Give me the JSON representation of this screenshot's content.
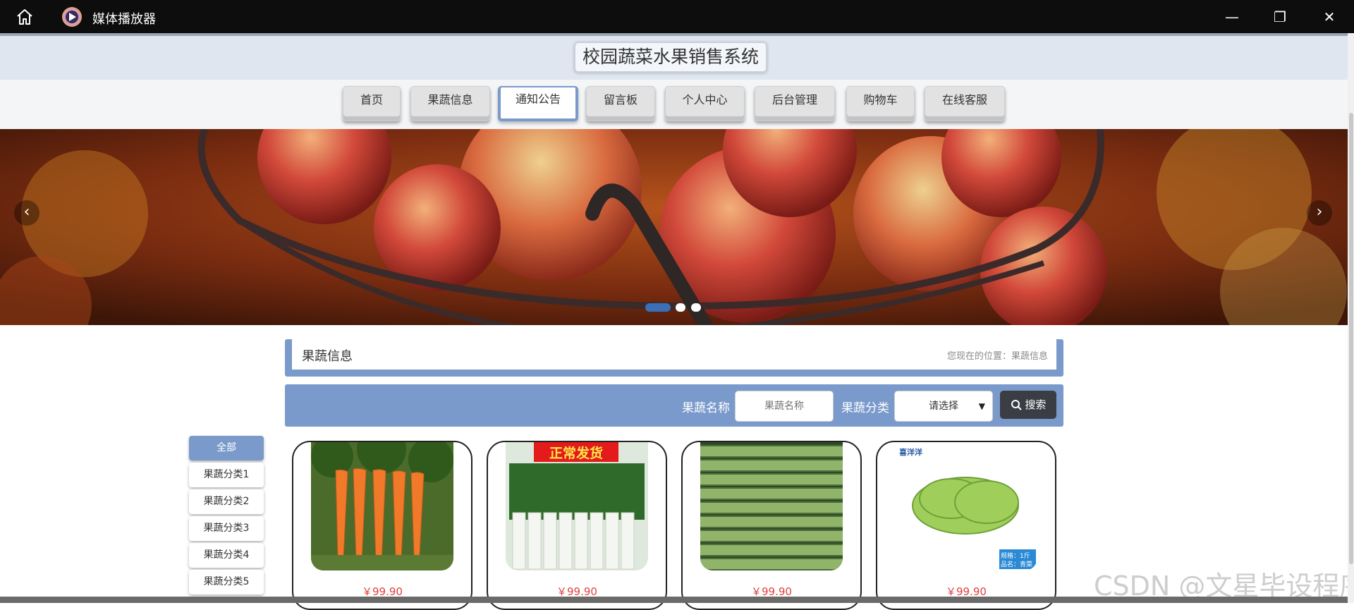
{
  "window": {
    "app_title": "媒体播放器",
    "minimize_glyph": "—",
    "restore_glyph": "❐",
    "close_glyph": "✕",
    "home_icon": "home-icon"
  },
  "site": {
    "title": "校园蔬菜水果销售系统"
  },
  "nav": {
    "items": [
      {
        "label": "首页"
      },
      {
        "label": "果蔬信息"
      },
      {
        "label": "通知公告"
      },
      {
        "label": "留言板"
      },
      {
        "label": "个人中心"
      },
      {
        "label": "后台管理"
      },
      {
        "label": "购物车"
      },
      {
        "label": "在线客服"
      }
    ],
    "active_index": 2
  },
  "carousel": {
    "prev_glyph": "‹",
    "next_glyph": "›",
    "slide_count": 3,
    "active_slide": 0
  },
  "breadcrumb": {
    "title": "果蔬信息",
    "path": "您现在的位置：果蔬信息"
  },
  "search": {
    "name_label": "果蔬名称",
    "name_placeholder": "果蔬名称",
    "category_label": "果蔬分类",
    "category_selected": "请选择",
    "button_label": "搜索"
  },
  "categories": [
    {
      "label": "全部",
      "active": true
    },
    {
      "label": "果蔬分类1"
    },
    {
      "label": "果蔬分类2"
    },
    {
      "label": "果蔬分类3"
    },
    {
      "label": "果蔬分类4"
    },
    {
      "label": "果蔬分类5"
    }
  ],
  "products": [
    {
      "image": "carrots",
      "price": "￥99.90"
    },
    {
      "image": "leeks",
      "badge": "正常发货",
      "price": "￥99.90"
    },
    {
      "image": "cucumbers",
      "price": "￥99.90"
    },
    {
      "image": "lettuce",
      "brand": "喜洋洋",
      "tag_line1": "规格：1斤",
      "tag_line2": "品名：青菜",
      "price": "￥99.90"
    }
  ],
  "watermark": "CSDN @文星毕设程序",
  "colors": {
    "accent": "#7a9acb",
    "titlebar": "#0d0d0d",
    "price": "#e04040",
    "search_button": "#3a3d44"
  }
}
